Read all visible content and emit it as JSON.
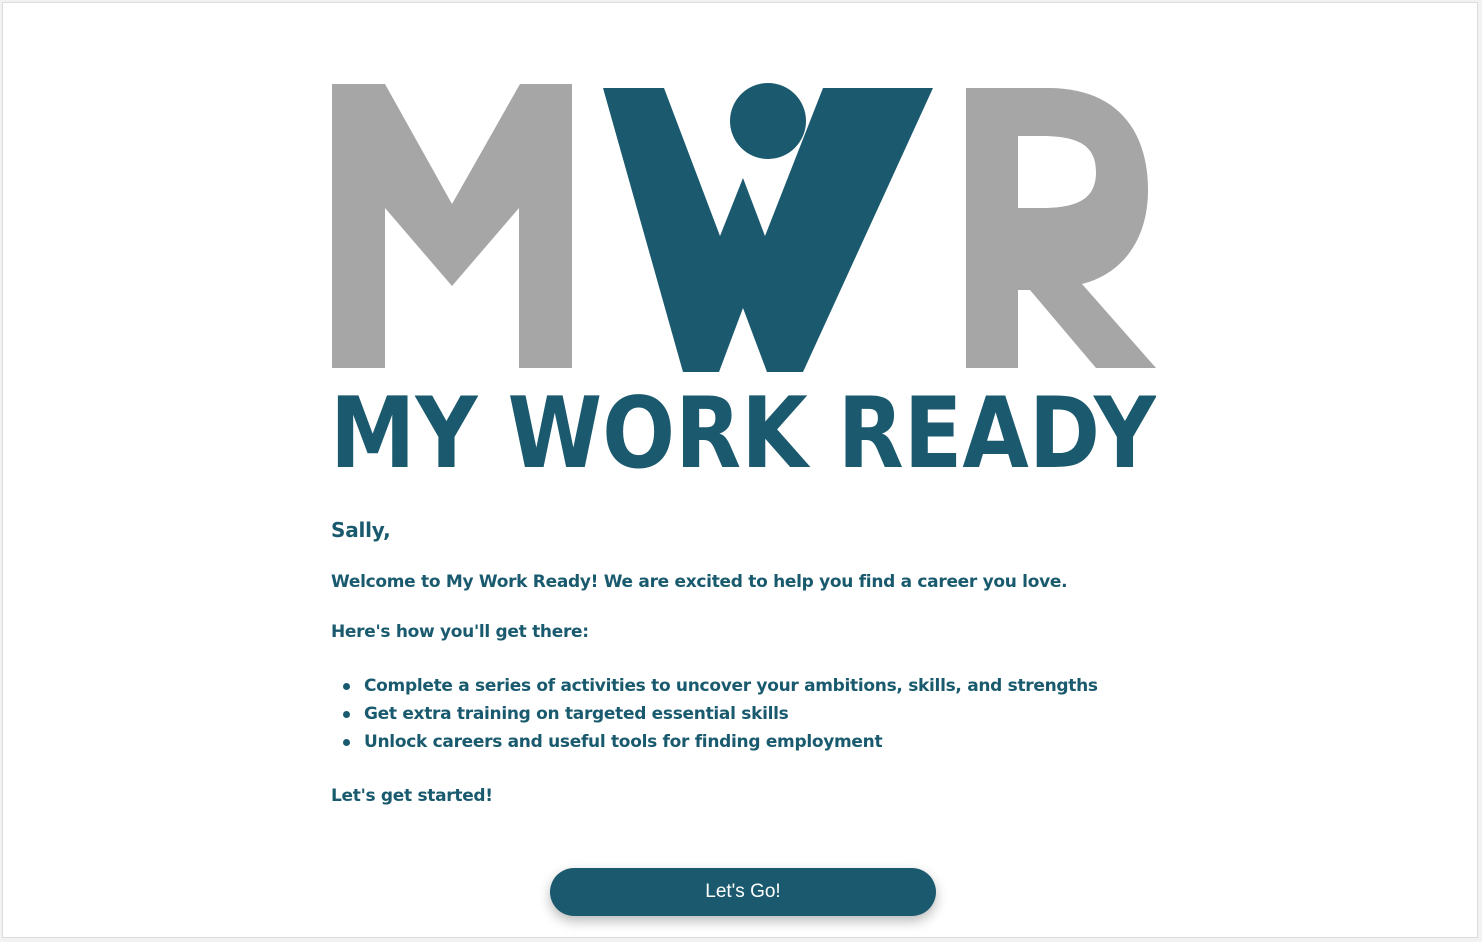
{
  "logo": {
    "letters": [
      "M",
      "W",
      "R"
    ],
    "wordmark": "MY WORK READY",
    "colors": {
      "gray": "#a6a6a6",
      "teal": "#1b5a6e"
    }
  },
  "message": {
    "greeting": "Sally,",
    "welcome": "Welcome to My Work Ready! We are excited to help you find a career you love.",
    "intro": "Here's how you'll get there:",
    "steps": [
      "Complete a series of activities to uncover your ambitions, skills, and strengths",
      "Get extra training on targeted essential skills",
      "Unlock careers and useful tools for finding employment"
    ],
    "closing": "Let's get started!"
  },
  "actions": {
    "go_label": "Let's Go!"
  }
}
